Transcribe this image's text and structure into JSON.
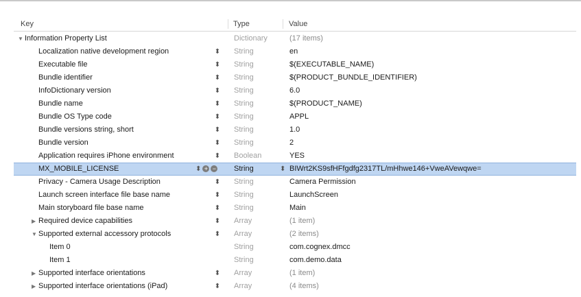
{
  "columns": {
    "key": "Key",
    "type": "Type",
    "value": "Value"
  },
  "root": {
    "key": "Information Property List",
    "type": "Dictionary",
    "value": "(17 items)"
  },
  "rows": [
    {
      "key": "Localization native development region",
      "type": "String",
      "value": "en"
    },
    {
      "key": "Executable file",
      "type": "String",
      "value": "$(EXECUTABLE_NAME)"
    },
    {
      "key": "Bundle identifier",
      "type": "String",
      "value": "$(PRODUCT_BUNDLE_IDENTIFIER)"
    },
    {
      "key": "InfoDictionary version",
      "type": "String",
      "value": "6.0"
    },
    {
      "key": "Bundle name",
      "type": "String",
      "value": "$(PRODUCT_NAME)"
    },
    {
      "key": "Bundle OS Type code",
      "type": "String",
      "value": "APPL"
    },
    {
      "key": "Bundle versions string, short",
      "type": "String",
      "value": "1.0"
    },
    {
      "key": "Bundle version",
      "type": "String",
      "value": "2"
    },
    {
      "key": "Application requires iPhone environment",
      "type": "Boolean",
      "value": "YES"
    },
    {
      "key": "MX_MOBILE_LICENSE",
      "type": "String",
      "value": "BIWrt2KS9sfHFfgdfg2317TL/mHhwe146+VweAVewqwe="
    },
    {
      "key": "Privacy - Camera Usage Description",
      "type": "String",
      "value": "Camera Permission"
    },
    {
      "key": "Launch screen interface file base name",
      "type": "String",
      "value": "LaunchScreen"
    },
    {
      "key": "Main storyboard file base name",
      "type": "String",
      "value": "Main"
    },
    {
      "key": "Required device capabilities",
      "type": "Array",
      "value": "(1 item)"
    },
    {
      "key": "Supported external accessory protocols",
      "type": "Array",
      "value": "(2 items)"
    },
    {
      "key": "Item 0",
      "type": "String",
      "value": "com.cognex.dmcc"
    },
    {
      "key": "Item 1",
      "type": "String",
      "value": "com.demo.data"
    },
    {
      "key": "Supported interface orientations",
      "type": "Array",
      "value": "(1 item)"
    },
    {
      "key": "Supported interface orientations (iPad)",
      "type": "Array",
      "value": "(4 items)"
    }
  ],
  "glyphs": {
    "stepper": "⌃⌄",
    "add": "+",
    "remove": "−"
  }
}
